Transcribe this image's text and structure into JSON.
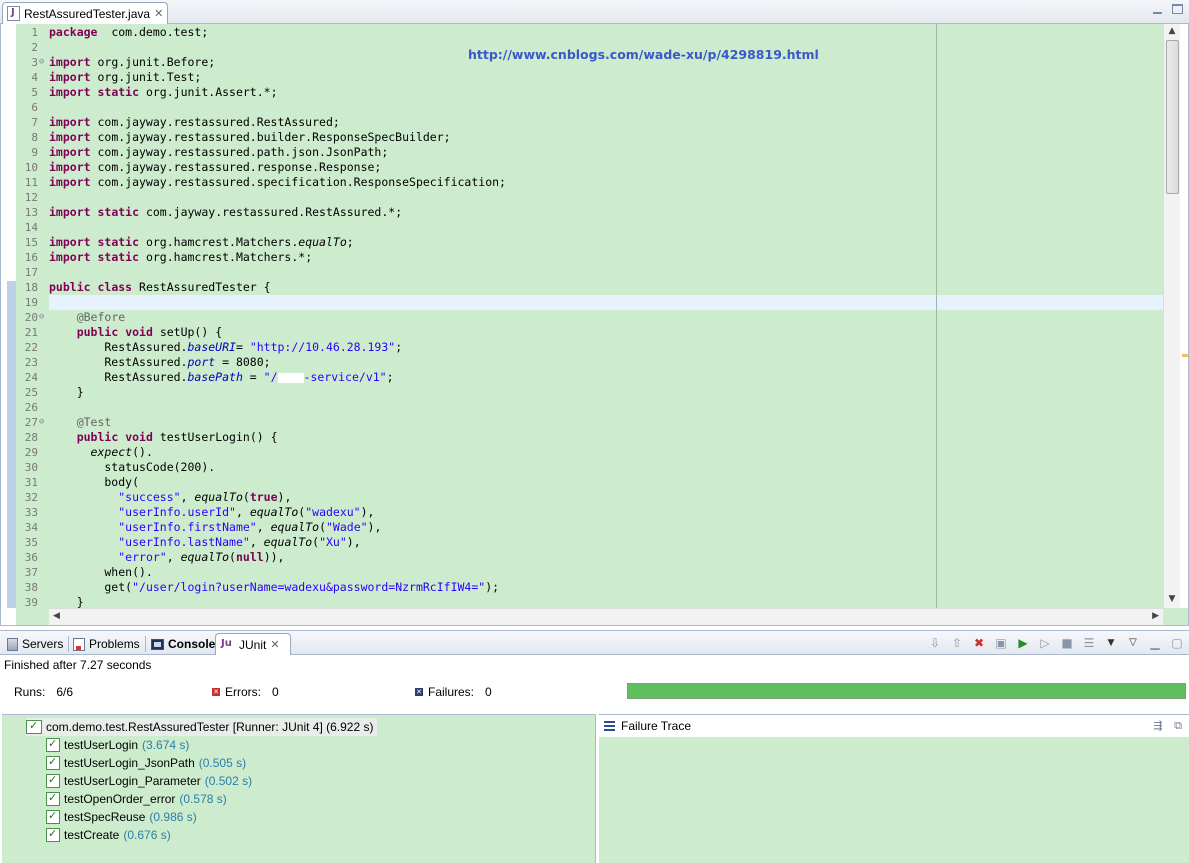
{
  "editor": {
    "tab_label": "RestAssuredTester.java",
    "overlay_link": "http://www.cnblogs.com/wade-xu/p/4298819.html",
    "lines": [
      {
        "n": "1",
        "t": [
          [
            "kw",
            "package"
          ],
          [
            "",
            "  com.demo.test;"
          ]
        ]
      },
      {
        "n": "2",
        "t": []
      },
      {
        "n": "3",
        "f": "⊖",
        "t": [
          [
            "kw",
            "import"
          ],
          [
            "",
            " org.junit.Before;"
          ]
        ]
      },
      {
        "n": "4",
        "t": [
          [
            "kw",
            "import"
          ],
          [
            "",
            " org.junit.Test;"
          ]
        ]
      },
      {
        "n": "5",
        "t": [
          [
            "kw",
            "import"
          ],
          [
            "",
            " "
          ],
          [
            "kw",
            "static"
          ],
          [
            "",
            " org.junit.Assert.*;"
          ]
        ]
      },
      {
        "n": "6",
        "t": []
      },
      {
        "n": "7",
        "t": [
          [
            "kw",
            "import"
          ],
          [
            "",
            " com.jayway.restassured.RestAssured;"
          ]
        ]
      },
      {
        "n": "8",
        "t": [
          [
            "kw",
            "import"
          ],
          [
            "",
            " com.jayway.restassured.builder.ResponseSpecBuilder;"
          ]
        ]
      },
      {
        "n": "9",
        "t": [
          [
            "kw",
            "import"
          ],
          [
            "",
            " com.jayway.restassured.path.json.JsonPath;"
          ]
        ]
      },
      {
        "n": "10",
        "t": [
          [
            "kw",
            "import"
          ],
          [
            "",
            " com.jayway.restassured.response.Response;"
          ]
        ]
      },
      {
        "n": "11",
        "t": [
          [
            "kw",
            "import"
          ],
          [
            "",
            " com.jayway.restassured.specification.ResponseSpecification;"
          ]
        ]
      },
      {
        "n": "12",
        "t": []
      },
      {
        "n": "13",
        "t": [
          [
            "kw",
            "import"
          ],
          [
            "",
            " "
          ],
          [
            "kw",
            "static"
          ],
          [
            "",
            " com.jayway.restassured.RestAssured.*;"
          ]
        ]
      },
      {
        "n": "14",
        "t": []
      },
      {
        "n": "15",
        "t": [
          [
            "kw",
            "import"
          ],
          [
            "",
            " "
          ],
          [
            "kw",
            "static"
          ],
          [
            "",
            " org.hamcrest.Matchers."
          ],
          [
            "smeth",
            "equalTo"
          ],
          [
            "",
            ";"
          ]
        ]
      },
      {
        "n": "16",
        "t": [
          [
            "kw",
            "import"
          ],
          [
            "",
            " "
          ],
          [
            "kw",
            "static"
          ],
          [
            "",
            " org.hamcrest.Matchers.*;"
          ]
        ]
      },
      {
        "n": "17",
        "t": []
      },
      {
        "n": "18",
        "t": [
          [
            "kw",
            "public"
          ],
          [
            "",
            " "
          ],
          [
            "kw",
            "class"
          ],
          [
            "",
            " RestAssuredTester {"
          ]
        ]
      },
      {
        "n": "19",
        "current": true,
        "t": []
      },
      {
        "n": "20",
        "f": "⊖",
        "t": [
          [
            "",
            "    "
          ],
          [
            "ann",
            "@Before"
          ]
        ]
      },
      {
        "n": "21",
        "t": [
          [
            "",
            "    "
          ],
          [
            "kw",
            "public"
          ],
          [
            "",
            " "
          ],
          [
            "kw",
            "void"
          ],
          [
            "",
            " setUp() {"
          ]
        ]
      },
      {
        "n": "22",
        "t": [
          [
            "",
            "        RestAssured."
          ],
          [
            "fld",
            "baseURI"
          ],
          [
            "",
            "= "
          ],
          [
            "str",
            "\"http://10.46.28.193\""
          ],
          [
            "",
            ";"
          ]
        ]
      },
      {
        "n": "23",
        "t": [
          [
            "",
            "        RestAssured."
          ],
          [
            "fld",
            "port"
          ],
          [
            "",
            " = 8080;"
          ]
        ]
      },
      {
        "n": "24",
        "t": [
          [
            "",
            "        RestAssured."
          ],
          [
            "fld",
            "basePath"
          ],
          [
            "",
            " = "
          ],
          [
            "str",
            "\"/"
          ],
          [
            "redact",
            ""
          ],
          [
            "str",
            "-service/v1\""
          ],
          [
            "",
            ";"
          ]
        ]
      },
      {
        "n": "25",
        "t": [
          [
            "",
            "    }"
          ]
        ]
      },
      {
        "n": "26",
        "t": []
      },
      {
        "n": "27",
        "f": "⊖",
        "t": [
          [
            "",
            "    "
          ],
          [
            "ann",
            "@Test"
          ]
        ]
      },
      {
        "n": "28",
        "t": [
          [
            "",
            "    "
          ],
          [
            "kw",
            "public"
          ],
          [
            "",
            " "
          ],
          [
            "kw",
            "void"
          ],
          [
            "",
            " testUserLogin() {"
          ]
        ]
      },
      {
        "n": "29",
        "t": [
          [
            "",
            "      "
          ],
          [
            "smeth",
            "expect"
          ],
          [
            "",
            "()."
          ]
        ]
      },
      {
        "n": "30",
        "t": [
          [
            "",
            "        statusCode(200)."
          ]
        ]
      },
      {
        "n": "31",
        "t": [
          [
            "",
            "        body("
          ]
        ]
      },
      {
        "n": "32",
        "t": [
          [
            "",
            "          "
          ],
          [
            "str",
            "\"success\""
          ],
          [
            "",
            ", "
          ],
          [
            "smeth",
            "equalTo"
          ],
          [
            "",
            "("
          ],
          [
            "kw",
            "true"
          ],
          [
            "",
            "),"
          ]
        ]
      },
      {
        "n": "33",
        "t": [
          [
            "",
            "          "
          ],
          [
            "str",
            "\"userInfo.userId\""
          ],
          [
            "",
            ", "
          ],
          [
            "smeth",
            "equalTo"
          ],
          [
            "",
            "("
          ],
          [
            "str",
            "\"wadexu\""
          ],
          [
            "",
            "),"
          ]
        ]
      },
      {
        "n": "34",
        "t": [
          [
            "",
            "          "
          ],
          [
            "str",
            "\"userInfo.firstName\""
          ],
          [
            "",
            ", "
          ],
          [
            "smeth",
            "equalTo"
          ],
          [
            "",
            "("
          ],
          [
            "str",
            "\"Wade\""
          ],
          [
            "",
            "),"
          ]
        ]
      },
      {
        "n": "35",
        "t": [
          [
            "",
            "          "
          ],
          [
            "str",
            "\"userInfo.lastName\""
          ],
          [
            "",
            ", "
          ],
          [
            "smeth",
            "equalTo"
          ],
          [
            "",
            "("
          ],
          [
            "str",
            "\"Xu\""
          ],
          [
            "",
            "),"
          ]
        ]
      },
      {
        "n": "36",
        "t": [
          [
            "",
            "          "
          ],
          [
            "str",
            "\"error\""
          ],
          [
            "",
            ", "
          ],
          [
            "smeth",
            "equalTo"
          ],
          [
            "",
            "("
          ],
          [
            "kw",
            "null"
          ],
          [
            "",
            ")),"
          ]
        ]
      },
      {
        "n": "37",
        "t": [
          [
            "",
            "        when()."
          ]
        ]
      },
      {
        "n": "38",
        "t": [
          [
            "",
            "        get("
          ],
          [
            "str",
            "\"/user/login?userName=wadexu&password=NzrmRcIfIW4=\""
          ],
          [
            "",
            ");"
          ]
        ]
      },
      {
        "n": "39",
        "t": [
          [
            "",
            "    }"
          ]
        ]
      }
    ]
  },
  "views": {
    "tabs": [
      {
        "label": "Servers",
        "icon": "servers-icon"
      },
      {
        "label": "Problems",
        "icon": "problems-icon"
      },
      {
        "label": "Console",
        "icon": "console-icon"
      },
      {
        "label": "JUnit",
        "icon": "junit-icon",
        "active": true
      }
    ]
  },
  "junit": {
    "status": "Finished after 7.27 seconds",
    "runs_label": "Runs:",
    "runs_value": "6/6",
    "errors_label": "Errors:",
    "errors_value": "0",
    "failures_label": "Failures:",
    "failures_value": "0",
    "progress_fraction": 1.0,
    "progress_color": "#5fbf5f",
    "root_label": "com.demo.test.RestAssuredTester [Runner: JUnit 4] (6.922 s)",
    "tests": [
      {
        "name": "testUserLogin",
        "duration": "(3.674 s)"
      },
      {
        "name": "testUserLogin_JsonPath",
        "duration": "(0.505 s)"
      },
      {
        "name": "testUserLogin_Parameter",
        "duration": "(0.502 s)"
      },
      {
        "name": "testOpenOrder_error",
        "duration": "(0.578 s)"
      },
      {
        "name": "testSpecReuse",
        "duration": "(0.986 s)"
      },
      {
        "name": "testCreate",
        "duration": "(0.676 s)"
      }
    ],
    "trace_title": "Failure Trace"
  },
  "colors": {
    "editor_bg": "#cdeccd",
    "keyword": "#7f0055",
    "string": "#2a00ff",
    "field": "#0000c0"
  }
}
